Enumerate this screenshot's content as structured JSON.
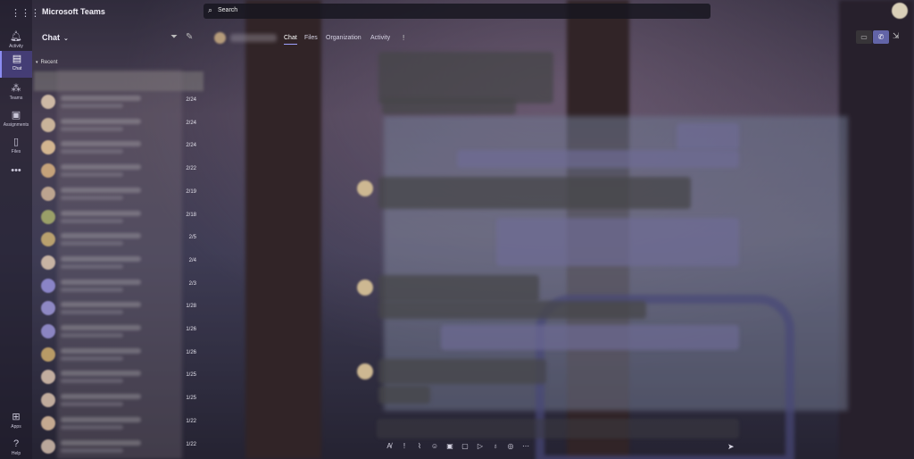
{
  "app": {
    "title": "Microsoft Teams",
    "search_label": "Search"
  },
  "rail": {
    "items": [
      {
        "label": "Activity",
        "icon": "bell-icon"
      },
      {
        "label": "Chat",
        "icon": "chat-icon",
        "active": true
      },
      {
        "label": "Teams",
        "icon": "teams-icon"
      },
      {
        "label": "Assignments",
        "icon": "assignments-icon"
      },
      {
        "label": "Files",
        "icon": "files-icon"
      }
    ],
    "more": "•••",
    "apps_label": "Apps",
    "help_label": "Help"
  },
  "chat_list": {
    "title": "Chat",
    "section": "Recent",
    "dates": [
      "2/24",
      "2/24",
      "2/24",
      "2/22",
      "2/19",
      "2/18",
      "2/5",
      "2/4",
      "2/3",
      "1/28",
      "1/26",
      "1/26",
      "1/25",
      "1/25",
      "1/22",
      "1/22"
    ]
  },
  "chat_header": {
    "tabs": [
      "Chat",
      "Files",
      "Organization",
      "Activity"
    ],
    "active_tab": "Chat",
    "more": "!"
  },
  "colors": {
    "accent": "#6264a7",
    "tab_underline": "#9ea2ff"
  }
}
